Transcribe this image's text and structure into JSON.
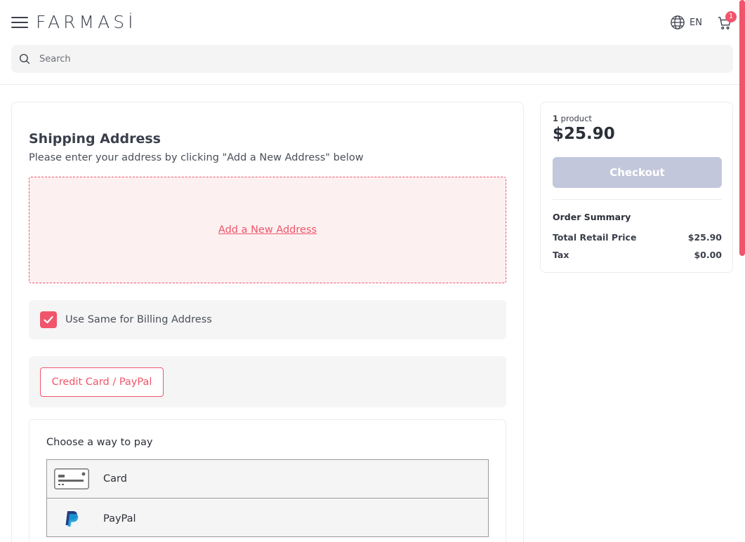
{
  "header": {
    "logo": "FARMASİ",
    "language": "EN",
    "cart_count": "1"
  },
  "search": {
    "placeholder": "Search"
  },
  "shipping": {
    "title": "Shipping Address",
    "subtitle": "Please enter your address by clicking \"Add a New Address\" below",
    "add_address": "Add a New Address"
  },
  "billing": {
    "label": "Use Same for Billing Address",
    "checked": true
  },
  "payment": {
    "method_button": "Credit Card / PayPal",
    "choose_title": "Choose a way to pay",
    "options": [
      {
        "label": "Card",
        "icon": "credit-card-icon"
      },
      {
        "label": "PayPal",
        "icon": "paypal-icon"
      }
    ]
  },
  "summary": {
    "count": "1",
    "count_label": " product",
    "total": "$25.90",
    "checkout": "Checkout",
    "title": "Order Summary",
    "rows": [
      {
        "label": "Total Retail Price",
        "value": "$25.90"
      },
      {
        "label": "Tax",
        "value": "$0.00"
      }
    ]
  },
  "colors": {
    "accent": "#f0556b",
    "checkout_disabled": "#c3c7db",
    "panel_bg": "#f5f5f5"
  }
}
